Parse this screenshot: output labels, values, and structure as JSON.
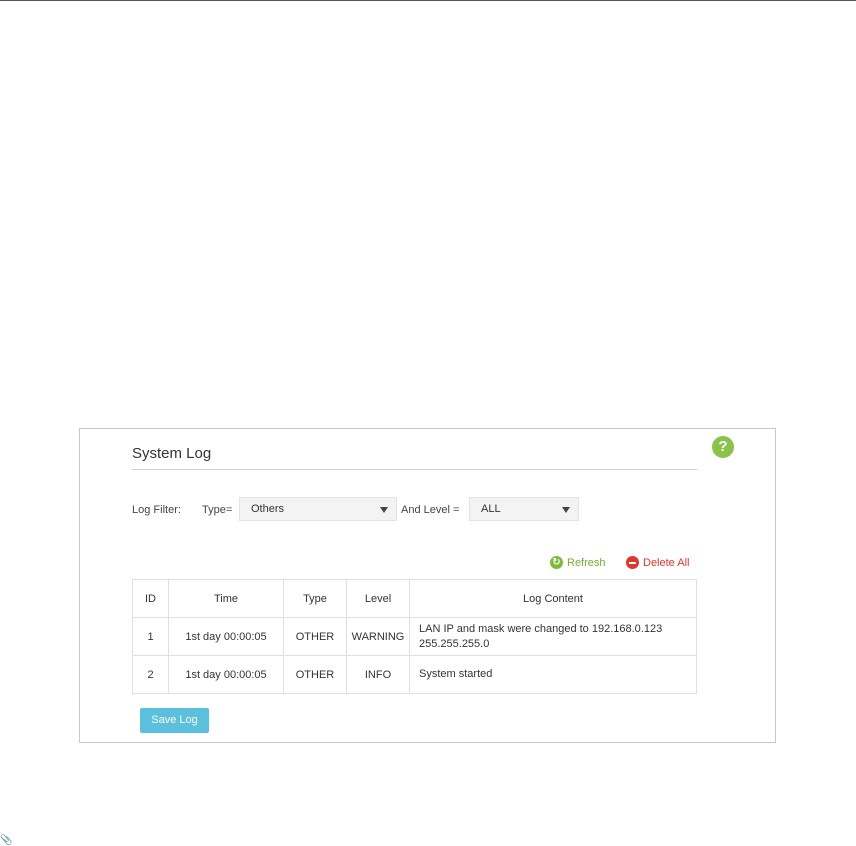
{
  "panel": {
    "title": "System Log",
    "help_icon": "question-icon",
    "help_label": "?"
  },
  "filter": {
    "label": "Log Filter:",
    "type_label": "Type=",
    "type_value": "Others",
    "level_label": "And Level =",
    "level_value": "ALL"
  },
  "actions": {
    "refresh_label": "Refresh",
    "refresh_icon": "refresh-icon",
    "delete_label": "Delete All",
    "delete_icon": "minus-circle-icon"
  },
  "table": {
    "headers": [
      "ID",
      "Time",
      "Type",
      "Level",
      "Log Content"
    ],
    "rows": [
      {
        "id": "1",
        "time": "1st day 00:00:05",
        "type": "OTHER",
        "level": "WARNING",
        "content_line1": "LAN IP and mask were changed to 192.168.0.123",
        "content_line2": "255.255.255.0"
      },
      {
        "id": "2",
        "time": "1st day 00:00:05",
        "type": "OTHER",
        "level": "INFO",
        "content_line1": "System started",
        "content_line2": ""
      }
    ]
  },
  "save_label": "Save Log",
  "colors": {
    "accent_green": "#7bbd37",
    "danger_red": "#e0362b",
    "button_blue": "#5bc0de"
  }
}
